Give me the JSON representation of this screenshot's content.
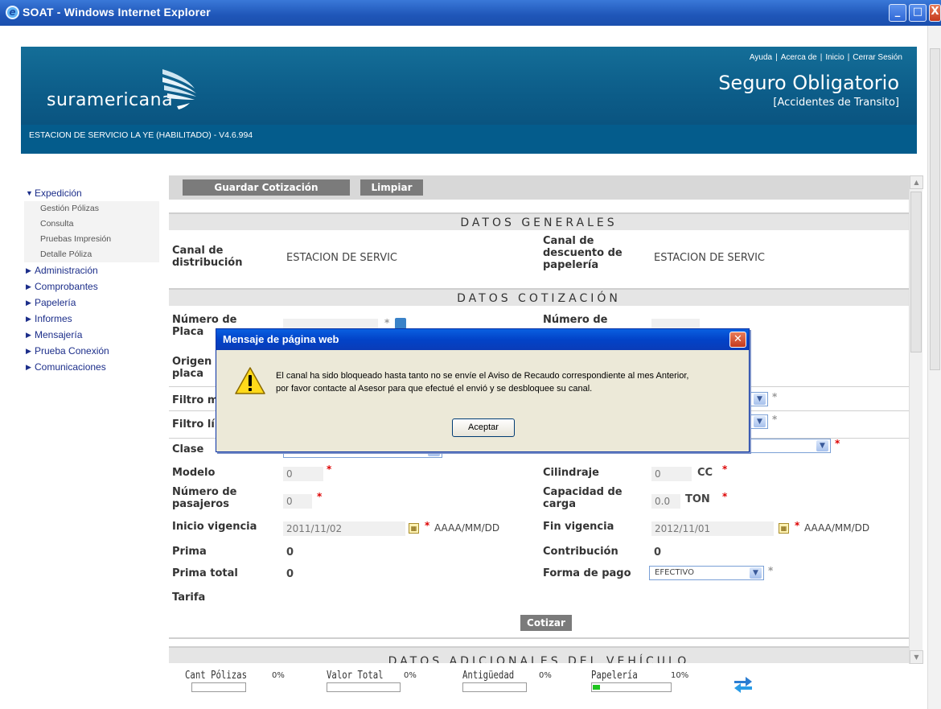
{
  "window": {
    "title": "SOAT - Windows Internet Explorer"
  },
  "header": {
    "logo": "suramericana",
    "links": [
      "Ayuda",
      "Acerca de",
      "Inicio",
      "Cerrar Sesión"
    ],
    "product_title": "Seguro Obligatorio",
    "product_subtitle": "[Accidentes de Transito]",
    "status": "ESTACION DE SERVICIO LA YE (HABILITADO) - V4.6.994"
  },
  "nav": {
    "expanded": "Expedición",
    "subitems": [
      "Gestión Pólizas",
      "Consulta",
      "Pruebas Impresión",
      "Detalle Póliza"
    ],
    "items": [
      "Administración",
      "Comprobantes",
      "Papelería",
      "Informes",
      "Mensajería",
      "Prueba Conexión",
      "Comunicaciones"
    ]
  },
  "toolbar": {
    "save": "Guardar Cotización",
    "clear": "Limpiar"
  },
  "generales": {
    "title": "DATOS GENERALES",
    "canal_label": "Canal de distribución",
    "canal_value": "ESTACION DE SERVIC",
    "desc_label": "Canal de descuento de papelería",
    "desc_value": "ESTACION DE SERVIC"
  },
  "cotizacion": {
    "title": "DATOS COTIZACIÓN",
    "placa_label": "Número de Placa",
    "poliza_label": "Número de",
    "origen_label": "Origen placa",
    "filtro_m_label": "Filtro m",
    "filtro_l_label": "Filtro lí",
    "clase_label": "Clase",
    "modelo_label": "Modelo",
    "modelo_value": "0",
    "cilindraje_label": "Cilindraje",
    "cilindraje_value": "0",
    "cilindraje_unit": "CC",
    "pasajeros_label": "Número de pasajeros",
    "pasajeros_value": "0",
    "carga_label": "Capacidad de carga",
    "carga_value": "0.0",
    "carga_unit": "TON",
    "inicio_label": "Inicio vigencia",
    "inicio_value": "2011/11/02",
    "fin_label": "Fin vigencia",
    "fin_value": "2012/11/01",
    "date_hint": "AAAA/MM/DD",
    "prima_label": "Prima",
    "prima_value": "0",
    "contrib_label": "Contribución",
    "contrib_value": "0",
    "total_label": "Prima total",
    "total_value": "0",
    "pago_label": "Forma de pago",
    "pago_value": "EFECTIVO",
    "tarifa_label": "Tarifa",
    "cotizar": "Cotizar"
  },
  "adicionales": {
    "title": "DATOS ADICIONALES DEL VEHÍCULO"
  },
  "footer": {
    "metrics": [
      {
        "label": "Cant Pólizas",
        "pct": "0%",
        "progress": 0
      },
      {
        "label": "Valor Total",
        "pct": "0%",
        "progress": 0
      },
      {
        "label": "Antigüedad",
        "pct": "0%",
        "progress": 0
      },
      {
        "label": "Papelería",
        "pct": "10%",
        "progress": 0.1
      }
    ]
  },
  "dialog": {
    "title": "Mensaje de página web",
    "line1": "El canal ha sido bloqueado hasta tanto no se envíe el Aviso de Recaudo correspondiente al mes Anterior,",
    "line2": "por favor contacte al Asesor para que efectué el envió y se desbloquee su canal.",
    "ok": "Aceptar"
  },
  "colors": {
    "banner": "#0d5e8a",
    "nav": "#1c2e8a",
    "required": "#dd0000"
  }
}
